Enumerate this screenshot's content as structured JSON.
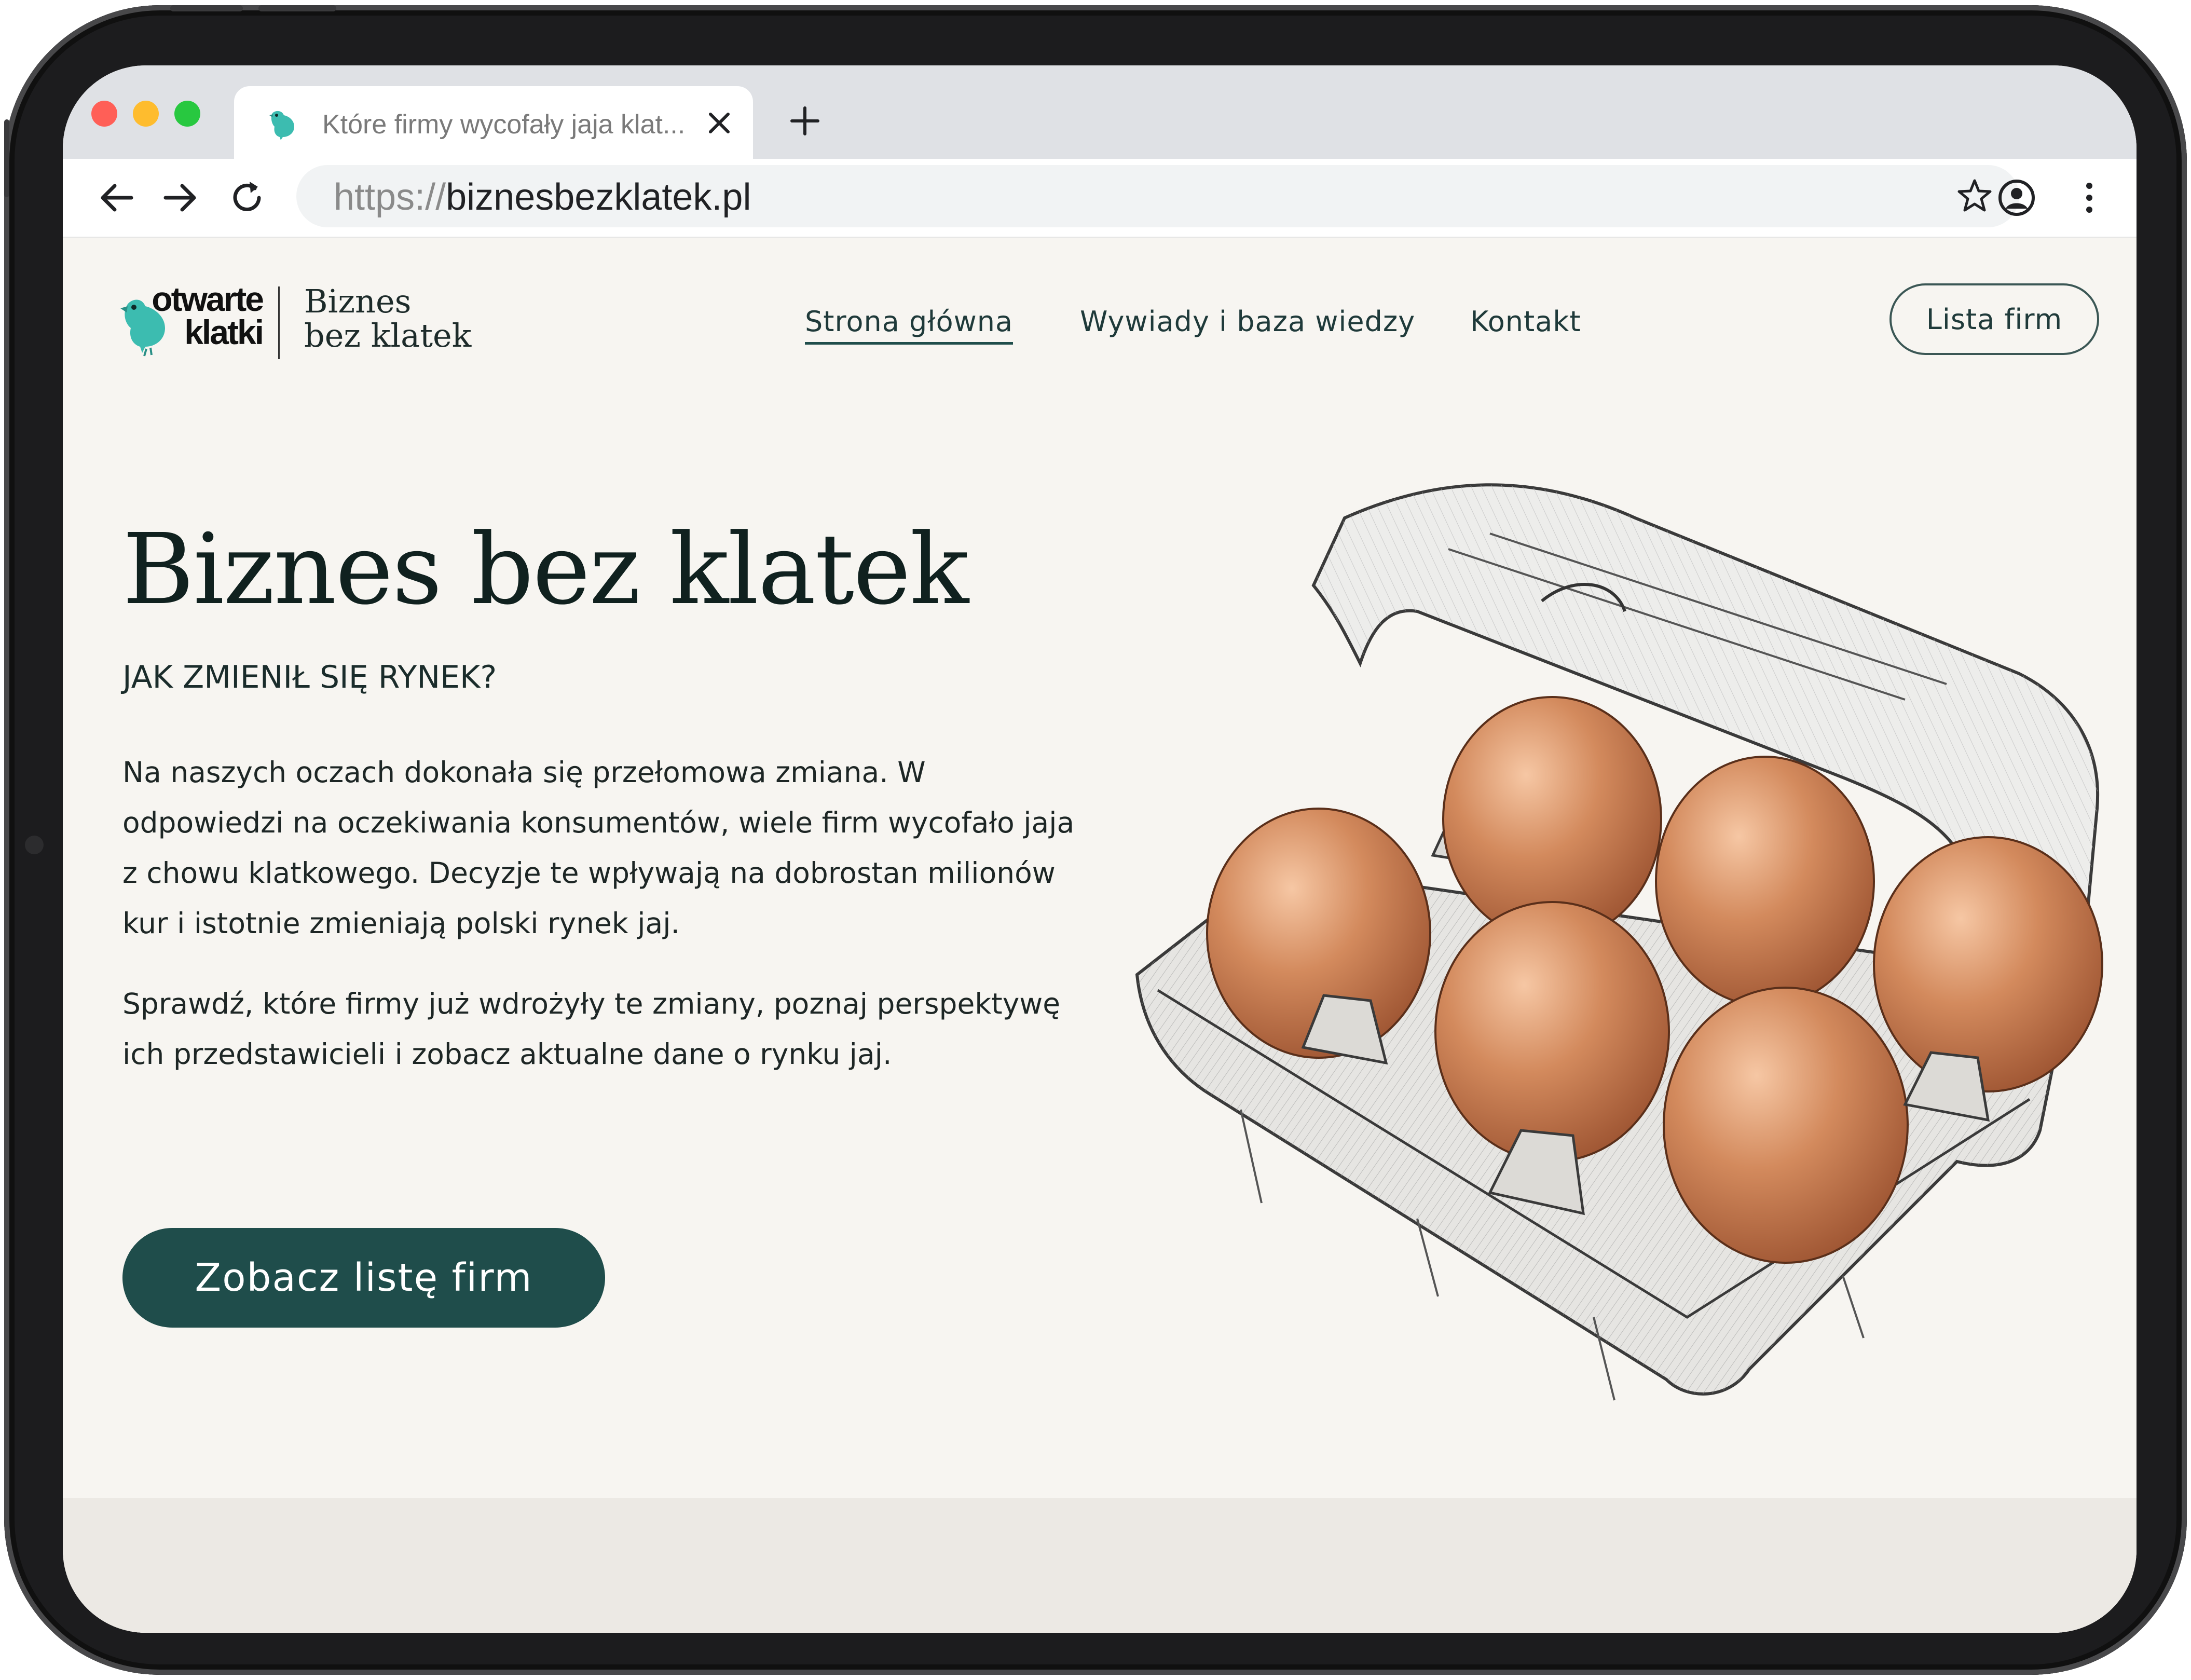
{
  "browser": {
    "tab_title": "Które firmy wycofały jaja klat...",
    "url_protocol": "https://",
    "url_domain": "biznesbezklatek.pl",
    "traffic_lights": [
      "#ff5f57",
      "#febc2e",
      "#28c840"
    ]
  },
  "site": {
    "logo_word_1": "otwarte",
    "logo_word_2": "klatki",
    "logo_title_1": "Biznes",
    "logo_title_2": "bez klatek",
    "nav": {
      "home": "Strona główna",
      "interviews": "Wywiady i baza wiedzy",
      "contact": "Kontakt"
    },
    "cta_outline": "Lista firm",
    "hero": {
      "title": "Biznes bez klatek",
      "subtitle": "JAK ZMIENIŁ SIĘ RYNEK?",
      "paragraph_1": "Na naszych oczach dokonała się przełomowa zmiana. W odpowiedzi na oczekiwania konsumentów, wiele firm wycofało jaja z chowu klatkowego. Decyzje te wpływają na dobrostan milionów kur i istotnie zmieniają polski rynek jaj.",
      "paragraph_2": "Sprawdź, które firmy już wdrożyły te zmiany, poznaj perspektywę ich przedstawicieli i zobacz aktualne dane o rynku jaj.",
      "cta": "Zobacz listę firm"
    },
    "colors": {
      "brand": "#1f4d4b",
      "bird_accent": "#3cbcb0",
      "background": "#f7f5f1"
    }
  }
}
